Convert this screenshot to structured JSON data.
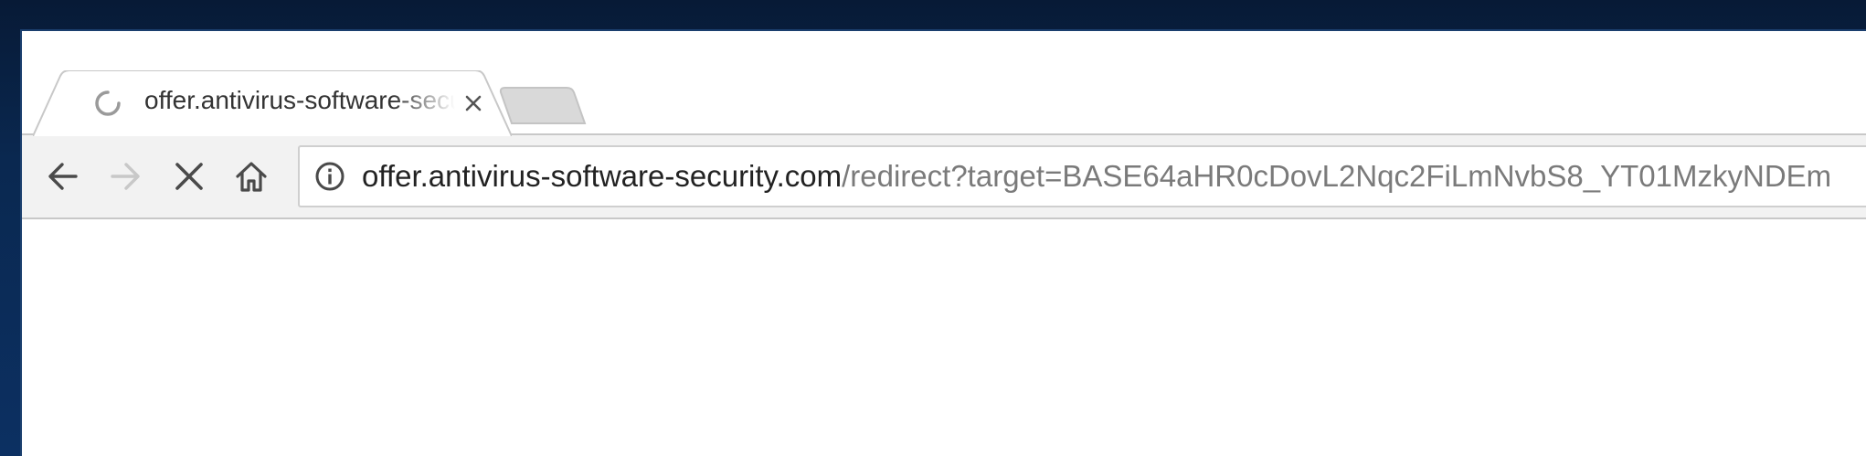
{
  "tab": {
    "title": "offer.antivirus-software-security.com",
    "loading": true,
    "spinner_icon": "loading-spinner-icon",
    "close_icon": "close-icon"
  },
  "new_tab": {
    "icon": "new-tab-button"
  },
  "toolbar": {
    "back_icon": "arrow-left-icon",
    "forward_icon": "arrow-right-icon",
    "stop_icon": "stop-x-icon",
    "home_icon": "home-icon",
    "forward_enabled": false
  },
  "omnibox": {
    "info_icon": "info-circle-icon",
    "url_host": "offer.antivirus-software-security.com",
    "url_path": "/redirect?target=BASE64aHR0cDovL2Nqc2FiLmNvbS8_YT01MzkyNDEm"
  },
  "colors": {
    "desktop_background": "#0a2850",
    "toolbar_background": "#f2f2f2",
    "url_host": "#222222",
    "url_path": "#7a7a7a"
  }
}
